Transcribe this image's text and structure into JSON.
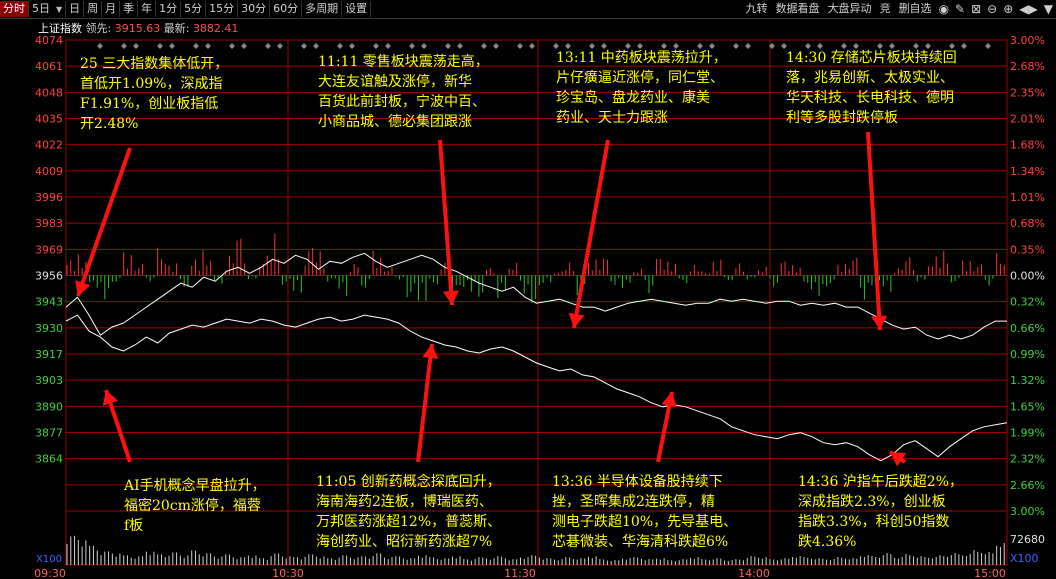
{
  "toolbar": {
    "tabs": [
      {
        "label": "分时",
        "active": true
      },
      {
        "label": "5日",
        "caret": "▼"
      },
      {
        "label": "日"
      },
      {
        "label": "周"
      },
      {
        "label": "月"
      },
      {
        "label": "季"
      },
      {
        "label": "年"
      },
      {
        "label": "1分"
      },
      {
        "label": "5分"
      },
      {
        "label": "15分"
      },
      {
        "label": "30分"
      },
      {
        "label": "60分"
      },
      {
        "label": "多周期"
      },
      {
        "label": "设置"
      }
    ],
    "right_buttons": [
      "九转",
      "数据看盘",
      "大盘异动",
      "竞",
      "删自选"
    ],
    "right_icons": [
      {
        "name": "eye-icon",
        "glyph": "◉"
      },
      {
        "name": "pen-icon",
        "glyph": "✎"
      },
      {
        "name": "delete-icon",
        "glyph": "⊠"
      },
      {
        "name": "zoom-out-icon",
        "glyph": "⊖"
      },
      {
        "name": "zoom-in-icon",
        "glyph": "⊕"
      },
      {
        "name": "pin-icon",
        "glyph": "◀▶"
      },
      {
        "name": "dropdown-icon",
        "glyph": "▼"
      }
    ]
  },
  "info": {
    "symbol": "上证指数",
    "lead_label": "领先:",
    "lead_value": "3915.63",
    "latest_label": "最新:",
    "latest_value": "3882.41"
  },
  "chart_data": {
    "type": "line",
    "prev_close": 3956,
    "y_ticks": [
      4074,
      4061,
      4048,
      4035,
      4022,
      4009,
      3996,
      3983,
      3969,
      3956,
      3943,
      3930,
      3917,
      3903,
      3890,
      3877,
      3864
    ],
    "pct_ticks": [
      "3.00%",
      "2.68%",
      "2.35%",
      "2.01%",
      "1.68%",
      "1.34%",
      "1.01%",
      "0.68%",
      "0.35%",
      "0.00%",
      "0.32%",
      "0.66%",
      "0.99%",
      "1.32%",
      "1.65%",
      "1.99%",
      "2.32%",
      "2.66%",
      "3.00%"
    ],
    "x_ticks": [
      "09:30",
      "10:30",
      "11:30",
      "14:00",
      "15:00"
    ],
    "vol_top_label": "72680",
    "vol_left_label": "X100",
    "vol_right_label": "X100",
    "series": [
      {
        "values": [
          3933,
          3936,
          3928,
          3925,
          3920,
          3918,
          3921,
          3925,
          3922,
          3927,
          3929,
          3931,
          3930,
          3932,
          3934,
          3933,
          3932,
          3934,
          3933,
          3931,
          3930,
          3932,
          3934,
          3935,
          3933,
          3934,
          3936,
          3935,
          3934,
          3932,
          3928,
          3925,
          3923,
          3921,
          3920,
          3918,
          3917,
          3919,
          3920,
          3918,
          3915,
          3912,
          3910,
          3908,
          3909,
          3906,
          3905,
          3902,
          3899,
          3897,
          3895,
          3892,
          3890,
          3891,
          3890,
          3888,
          3886,
          3884,
          3880,
          3878,
          3876,
          3875,
          3874,
          3876,
          3877,
          3875,
          3872,
          3871,
          3872,
          3870,
          3866,
          3863,
          3866,
          3871,
          3873,
          3869,
          3865,
          3870,
          3874,
          3878,
          3880,
          3881,
          3882
        ]
      },
      {
        "values": [
          3940,
          3945,
          3936,
          3926,
          3930,
          3932,
          3936,
          3940,
          3944,
          3948,
          3952,
          3950,
          3955,
          3953,
          3958,
          3960,
          3957,
          3960,
          3964,
          3962,
          3966,
          3964,
          3959,
          3963,
          3962,
          3965,
          3967,
          3963,
          3960,
          3962,
          3964,
          3966,
          3964,
          3960,
          3958,
          3955,
          3952,
          3950,
          3948,
          3950,
          3945,
          3942,
          3943,
          3944,
          3942,
          3940,
          3940,
          3938,
          3940,
          3942,
          3943,
          3944,
          3943,
          3942,
          3941,
          3942,
          3942,
          3944,
          3943,
          3944,
          3943,
          3942,
          3943,
          3943,
          3941,
          3942,
          3941,
          3942,
          3940,
          3940,
          3937,
          3934,
          3931,
          3929,
          3930,
          3926,
          3924,
          3926,
          3924,
          3926,
          3930,
          3933,
          3933
        ]
      }
    ],
    "volume": [
      30,
      26,
      20,
      14,
      12,
      10,
      9,
      14,
      11,
      13,
      10,
      15,
      12,
      9,
      11,
      8,
      10,
      7,
      12,
      9,
      8,
      11,
      9,
      7,
      10,
      8,
      9,
      12,
      8,
      9,
      7,
      10,
      8,
      7,
      9,
      6,
      8,
      7,
      9,
      6,
      8,
      10,
      7,
      6,
      8,
      7,
      9,
      6,
      5,
      7,
      8,
      6,
      7,
      5,
      6,
      8,
      6,
      7,
      5,
      6,
      9,
      8,
      6,
      7,
      9,
      8,
      7,
      6,
      8,
      7,
      10,
      9,
      12,
      8,
      11,
      9,
      8,
      10,
      12,
      11,
      15,
      13,
      22
    ],
    "bars": [
      8,
      10,
      -6,
      -12,
      -4,
      12,
      6,
      -3,
      14,
      6,
      -7,
      8,
      12,
      -4,
      10,
      22,
      -2,
      10,
      20,
      -5,
      -9,
      16,
      12,
      -3,
      -10,
      6,
      -7,
      12,
      4,
      -2,
      -12,
      -14,
      -5,
      6,
      -10,
      -8,
      -12,
      4,
      -11,
      6,
      -9,
      -16,
      -4,
      2,
      6,
      -10,
      8,
      10,
      -5,
      -6,
      3,
      -9,
      10,
      7,
      -4,
      5,
      2,
      8,
      -3,
      6,
      -2,
      4,
      -6,
      8,
      5,
      -7,
      -10,
      -6,
      6,
      10,
      -12,
      -5,
      -8,
      4,
      10,
      -3,
      9,
      12,
      -4,
      8,
      6,
      -5,
      11
    ]
  },
  "annotations": [
    {
      "name": "annotation-open",
      "lines": [
        "25 三大指数集体低开，",
        "首低开1.09%，深成指",
        "F1.91%，创业板指低",
        "开2.48%"
      ]
    },
    {
      "name": "annotation-1111",
      "lines": [
        "11:11 零售板块震荡走高，",
        "大连友谊触及涨停，新华",
        "百货此前封板，宁波中百、",
        "小商品城、德必集团跟涨"
      ]
    },
    {
      "name": "annotation-1311",
      "lines": [
        "13:11 中药板块震荡拉升，",
        "片仔癀逼近涨停，同仁堂、",
        "珍宝岛、盘龙药业、康美",
        "药业、天士力跟涨"
      ]
    },
    {
      "name": "annotation-1430",
      "lines": [
        "14:30 存储芯片板块持续回",
        "落，兆易创新、太极实业、",
        "华天科技、长电科技、德明",
        "利等多股封跌停板"
      ]
    },
    {
      "name": "annotation-ai",
      "lines": [
        "AI手机概念早盘拉升，",
        "福密20cm涨停，福蓉",
        "f板"
      ]
    },
    {
      "name": "annotation-1105",
      "lines": [
        "11:05 创新药概念探底回升，",
        "海南海药2连板，博瑞医药、",
        "万邦医药涨超12%，普蕊斯、",
        "海创药业、昭衍新药涨超7%"
      ]
    },
    {
      "name": "annotation-1336",
      "lines": [
        "13:36 半导体设备股持续下",
        "挫，圣晖集成2连跌停，精",
        "测电子跌超10%，先导基电、",
        "芯碁微装、华海清科跌超6%"
      ]
    },
    {
      "name": "annotation-1436",
      "lines": [
        "14:36 沪指午后跌超2%，",
        "深成指跌2.3%，创业板",
        "指跌3.3%，科创50指数",
        "跌4.36%"
      ]
    }
  ],
  "colors": {
    "up": "#ff3030",
    "down": "#30c030",
    "grid": "#a00000",
    "line": "#ffffff",
    "annotation": "#ffff00",
    "arrow": "#ff1010",
    "tick_up": "#ff4040",
    "tick_flat": "#e0e0e0",
    "tick_down": "#40d040"
  }
}
